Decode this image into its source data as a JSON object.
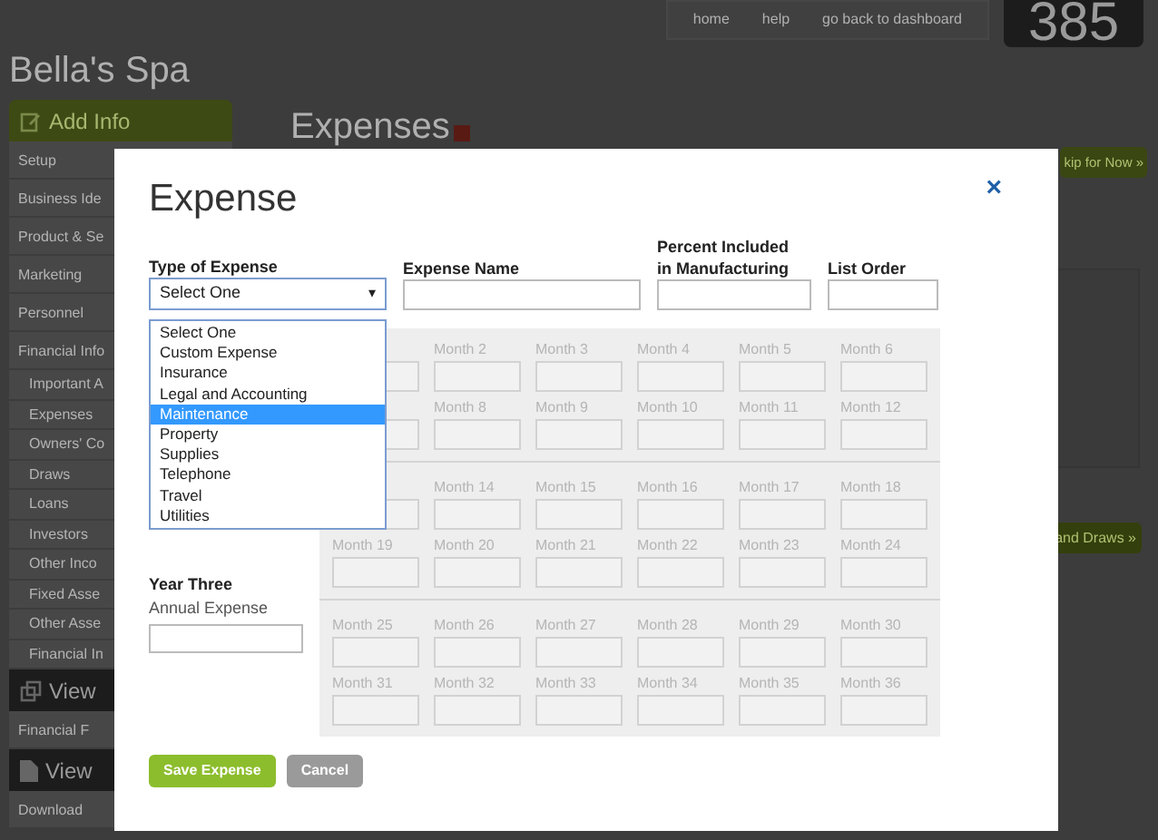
{
  "top_nav": {
    "links": [
      "home",
      "help",
      "go back to dashboard"
    ],
    "counter": "385"
  },
  "site_title": "Bella's Spa",
  "sidebar": {
    "sections": [
      {
        "title": "Add Info",
        "kind": "green",
        "items": [
          {
            "label": "Setup",
            "sub": false
          },
          {
            "label": "Business Ide",
            "sub": false
          },
          {
            "label": "Product & Se",
            "sub": false
          },
          {
            "label": "Marketing",
            "sub": false
          },
          {
            "label": "Personnel",
            "sub": false
          },
          {
            "label": "Financial Info",
            "sub": false
          },
          {
            "label": "Important A",
            "sub": true
          },
          {
            "label": "Expenses",
            "sub": true
          },
          {
            "label": "Owners' Co",
            "sub": true
          },
          {
            "label": "Draws",
            "sub": true
          },
          {
            "label": "Loans",
            "sub": true
          },
          {
            "label": "Investors",
            "sub": true
          },
          {
            "label": "Other Inco",
            "sub": true
          },
          {
            "label": "Fixed Asse",
            "sub": true
          },
          {
            "label": "Other Asse",
            "sub": true
          },
          {
            "label": "Financial In",
            "sub": true
          }
        ]
      },
      {
        "title": "View",
        "kind": "dark",
        "items": [
          {
            "label": "Financial F",
            "sub": false
          }
        ]
      },
      {
        "title": "View",
        "kind": "dark",
        "items": [
          {
            "label": "Download",
            "sub": false
          }
        ]
      }
    ]
  },
  "main": {
    "heading": "Expenses",
    "skip_button": "kip for Now »",
    "next_button": "and Draws »"
  },
  "modal": {
    "title": "Expense",
    "close": "×",
    "fields": [
      {
        "label": "Type of Expense",
        "kind": "select",
        "value": "Select One",
        "caret": "▾"
      },
      {
        "label": "Expense Name",
        "kind": "input"
      },
      {
        "label": "Percent Included in Manufacturing",
        "kind": "input"
      },
      {
        "label": "List Order",
        "kind": "input"
      }
    ],
    "dropdown": {
      "options": [
        {
          "label": "Select One",
          "selected": false
        },
        {
          "label": "Custom Expense",
          "selected": false
        },
        {
          "label": "Insurance",
          "selected": false
        },
        {
          "label": "Legal and Accounting",
          "selected": false
        },
        {
          "label": "Maintenance",
          "selected": true
        },
        {
          "label": "Property",
          "selected": false
        },
        {
          "label": "Supplies",
          "selected": false
        },
        {
          "label": "Telephone",
          "selected": false
        },
        {
          "label": "Travel",
          "selected": false
        },
        {
          "label": "Utilities",
          "selected": false
        }
      ]
    },
    "year_three": {
      "title": "Year Three",
      "label": "Annual Expense"
    },
    "month_sections": [
      {
        "rows": [
          [
            "",
            "Month 2",
            "Month 3",
            "Month 4",
            "Month 5",
            "Month 6"
          ],
          [
            "",
            "Month 8",
            "Month 9",
            "Month 10",
            "Month 11",
            "Month 12"
          ]
        ]
      },
      {
        "rows": [
          [
            "",
            "Month 14",
            "Month 15",
            "Month 16",
            "Month 17",
            "Month 18"
          ],
          [
            "Month 19",
            "Month 20",
            "Month 21",
            "Month 22",
            "Month 23",
            "Month 24"
          ]
        ]
      },
      {
        "rows": [
          [
            "Month 25",
            "Month 26",
            "Month 27",
            "Month 28",
            "Month 29",
            "Month 30"
          ],
          [
            "Month 31",
            "Month 32",
            "Month 33",
            "Month 34",
            "Month 35",
            "Month 36"
          ]
        ]
      }
    ],
    "buttons": [
      {
        "label": "Save Expense",
        "kind": "primary"
      },
      {
        "label": "Cancel",
        "kind": "secondary"
      }
    ]
  }
}
